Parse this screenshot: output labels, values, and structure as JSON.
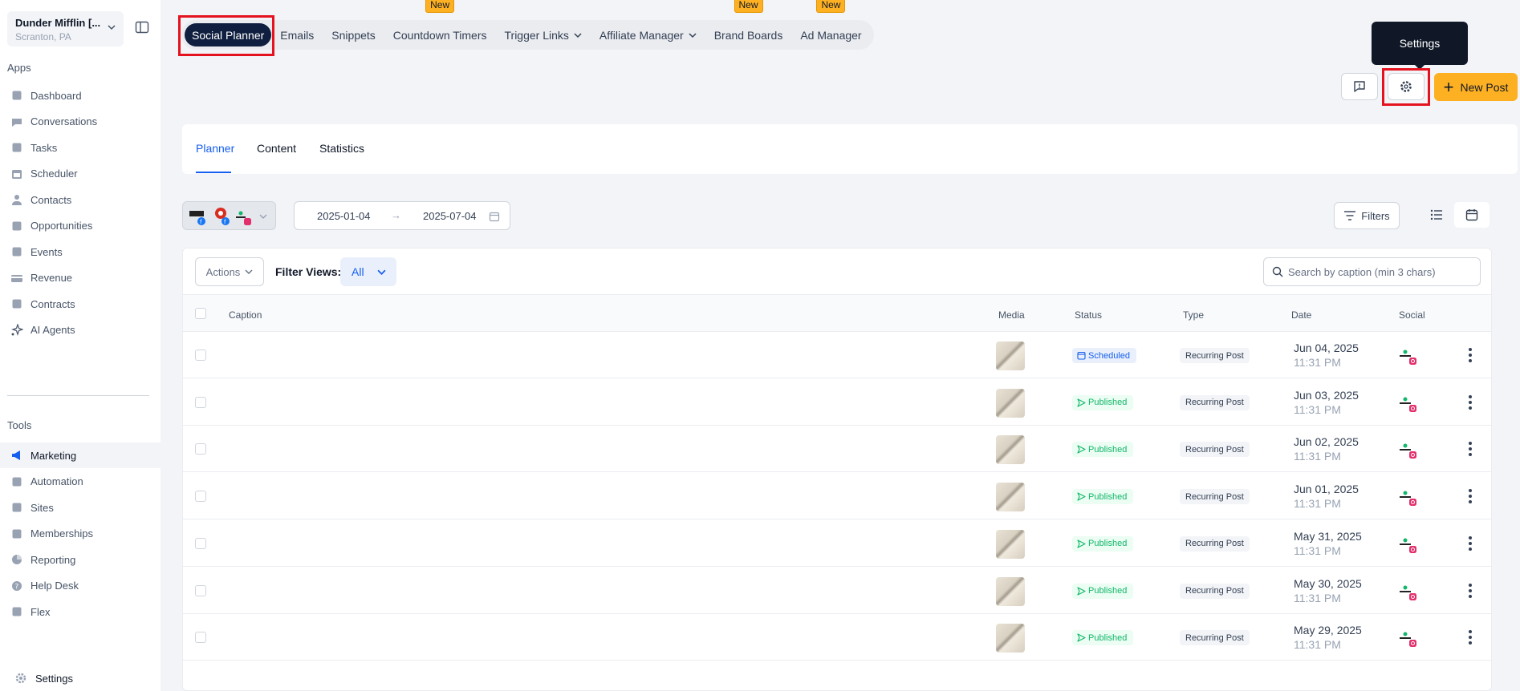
{
  "location": {
    "name": "Dunder Mifflin [...",
    "address": "Scranton, PA"
  },
  "sidebar": {
    "apps_label": "Apps",
    "apps": [
      {
        "label": "Dashboard",
        "icon": "dashboard-icon"
      },
      {
        "label": "Conversations",
        "icon": "chat-icon"
      },
      {
        "label": "Tasks",
        "icon": "tasks-icon"
      },
      {
        "label": "Scheduler",
        "icon": "calendar-icon"
      },
      {
        "label": "Contacts",
        "icon": "user-icon"
      },
      {
        "label": "Opportunities",
        "icon": "target-icon"
      },
      {
        "label": "Events",
        "icon": "events-icon"
      },
      {
        "label": "Revenue",
        "icon": "card-icon"
      },
      {
        "label": "Contracts",
        "icon": "document-icon"
      },
      {
        "label": "AI Agents",
        "icon": "sparkle-icon"
      }
    ],
    "tools_label": "Tools",
    "tools": [
      {
        "label": "Marketing",
        "icon": "megaphone-icon",
        "active": true
      },
      {
        "label": "Automation",
        "icon": "gears-icon"
      },
      {
        "label": "Sites",
        "icon": "sites-icon"
      },
      {
        "label": "Memberships",
        "icon": "people-icon"
      },
      {
        "label": "Reporting",
        "icon": "pie-icon"
      },
      {
        "label": "Help Desk",
        "icon": "help-icon"
      },
      {
        "label": "Flex",
        "icon": "flex-icon"
      }
    ],
    "settings_label": "Settings"
  },
  "top_tabs": [
    {
      "label": "Social Planner",
      "active": true
    },
    {
      "label": "Emails"
    },
    {
      "label": "Snippets"
    },
    {
      "label": "Countdown Timers",
      "badge": "New"
    },
    {
      "label": "Trigger Links",
      "dropdown": true
    },
    {
      "label": "Affiliate Manager",
      "dropdown": true
    },
    {
      "label": "Brand Boards",
      "badge": "New"
    },
    {
      "label": "Ad Manager",
      "badge": "New"
    }
  ],
  "tooltip": "Settings",
  "new_post_label": "New Post",
  "sub_tabs": [
    "Planner",
    "Content",
    "Statistics"
  ],
  "date_range": {
    "start": "2025-01-04",
    "end": "2025-07-04"
  },
  "filters_label": "Filters",
  "table": {
    "actions_label": "Actions",
    "filter_views_label": "Filter Views:",
    "filter_views_value": "All",
    "search_placeholder": "Search by caption (min 3 chars)",
    "columns": [
      "Caption",
      "Media",
      "Status",
      "Type",
      "Date",
      "Social"
    ],
    "rows": [
      {
        "status": "Scheduled",
        "type": "Recurring Post",
        "date": "Jun 04, 2025",
        "time": "11:31 PM"
      },
      {
        "status": "Published",
        "type": "Recurring Post",
        "date": "Jun 03, 2025",
        "time": "11:31 PM"
      },
      {
        "status": "Published",
        "type": "Recurring Post",
        "date": "Jun 02, 2025",
        "time": "11:31 PM"
      },
      {
        "status": "Published",
        "type": "Recurring Post",
        "date": "Jun 01, 2025",
        "time": "11:31 PM"
      },
      {
        "status": "Published",
        "type": "Recurring Post",
        "date": "May 31, 2025",
        "time": "11:31 PM"
      },
      {
        "status": "Published",
        "type": "Recurring Post",
        "date": "May 30, 2025",
        "time": "11:31 PM"
      },
      {
        "status": "Published",
        "type": "Recurring Post",
        "date": "May 29, 2025",
        "time": "11:31 PM"
      }
    ]
  },
  "colors": {
    "accent": "#155eef",
    "brand_yellow": "#fdb022",
    "highlight": "#e5131f",
    "dark_tab": "#101f3f"
  }
}
